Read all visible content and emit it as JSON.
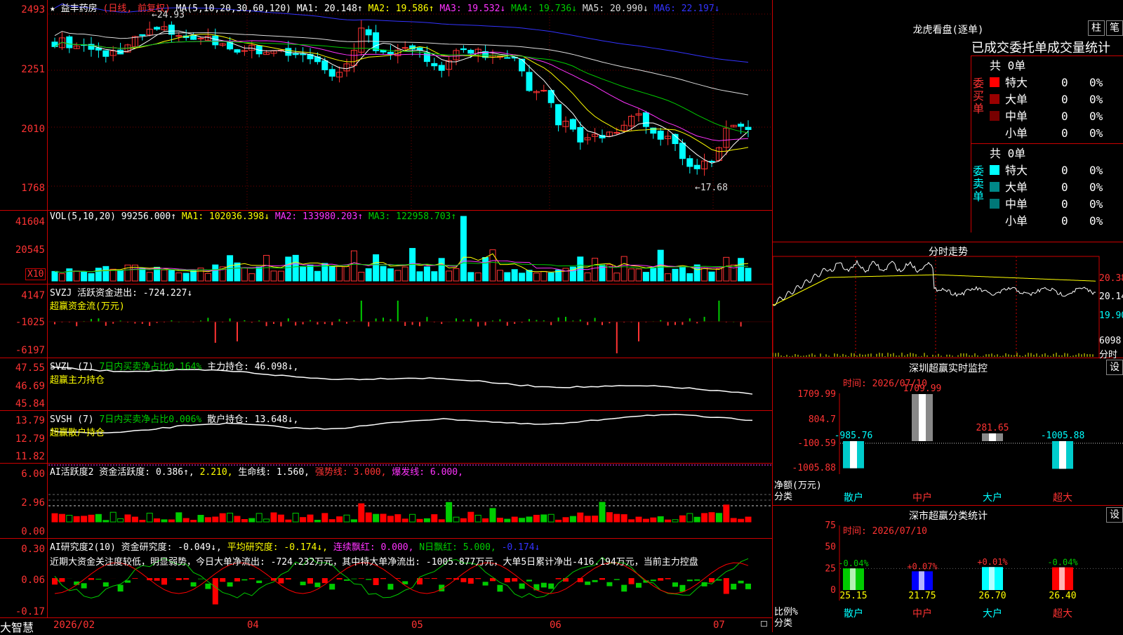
{
  "stock": {
    "star": "★",
    "name": "益丰药房",
    "period": "(日线, 前复权)"
  },
  "ma": {
    "label": "MA(5,10,20,30,60,120)",
    "ma1": "MA1: 20.148↑",
    "ma2": "MA2: 19.586↑",
    "ma3": "MA3: 19.532↓",
    "ma4": "MA4: 19.736↓",
    "ma5": "MA5: 20.990↓",
    "ma6": "MA6: 22.197↓"
  },
  "kline": {
    "y_labels": [
      "2493",
      "2251",
      "2010",
      "1768"
    ],
    "high_label": "←24.93",
    "low_label": "←17.68"
  },
  "vol": {
    "label": "VOL(5,10,20)",
    "v": "99256.000↑",
    "ma1": "MA1: 102036.398↓",
    "ma2": "MA2: 133980.203↑",
    "ma3": "MA3: 122958.703↑",
    "y_labels": [
      "41604",
      "20545"
    ],
    "unit": "X10"
  },
  "svzj": {
    "label": "SVZJ  活跃资金进出: -724.227↓",
    "sub": "超赢资金流(万元)",
    "y_labels": [
      "4147",
      "-1025",
      "-6197"
    ]
  },
  "svzl": {
    "label": "SVZL (7)",
    "pct": "7日内买卖净占比0.164%",
    "hold": "主力持仓: 46.098↓,",
    "sub": "超赢主力持仓",
    "y_labels": [
      "47.55",
      "46.69",
      "45.84"
    ]
  },
  "svsh": {
    "label": "SVSH (7)",
    "pct": "7日内买卖净占比0.006%",
    "hold": "散户持仓: 13.648↓,",
    "sub": "超赢散户持仓",
    "y_labels": [
      "13.79",
      "12.79",
      "11.82"
    ]
  },
  "ai1": {
    "label": "AI活跃度2 资金活跃度: 0.386↑,",
    "v2": "2.210,",
    "life": "生命线: 1.560,",
    "strong": "强势线: 3.000,",
    "burst": "爆发线: 6.000,",
    "y_labels": [
      "6.00",
      "2.96",
      "0.00"
    ]
  },
  "ai2": {
    "label": "AI研究度2(10) 资金研究度: -0.049↓,",
    "avg": "平均研究度: -0.174↓,",
    "lianxu": "连续飘红: 0.000,",
    "nday": "N日飘红: 5.000,",
    "last": "-0.174↓",
    "comment": "近期大资金关注度较低，明显弱势，今日大单净流出: -724.232万元，其中特大单净流出: -1005.877万元，大单5日累计净出-416.194万元，当前主力控盘",
    "y_labels": [
      "0.30",
      "0.06",
      "-0.17"
    ]
  },
  "xaxis": {
    "brand": "大智慧",
    "labels": [
      "2026/02",
      "04",
      "05",
      "06",
      "07"
    ]
  },
  "dragon": {
    "title": "龙虎看盘(逐单)",
    "btn1": "柱",
    "btn2": "笔",
    "subtitle": "已成交委托单成交量统计",
    "buy_label": [
      "委",
      "买",
      "单"
    ],
    "sell_label": [
      "委",
      "卖",
      "单"
    ],
    "buy_total": "共 0单",
    "sell_total": "共 0单",
    "buy_rows": [
      {
        "label": "特大",
        "color": "#f00",
        "count": "0",
        "pct": "0%"
      },
      {
        "label": "大单",
        "color": "#900",
        "count": "0",
        "pct": "0%"
      },
      {
        "label": "中单",
        "color": "#700",
        "count": "0",
        "pct": "0%"
      },
      {
        "label": "小单",
        "color": "",
        "count": "0",
        "pct": "0%"
      }
    ],
    "sell_rows": [
      {
        "label": "特大",
        "color": "#0ff",
        "count": "0",
        "pct": "0%"
      },
      {
        "label": "大单",
        "color": "#088",
        "count": "0",
        "pct": "0%"
      },
      {
        "label": "中单",
        "color": "#077",
        "count": "0",
        "pct": "0%"
      },
      {
        "label": "小单",
        "color": "",
        "count": "0",
        "pct": "0%"
      }
    ]
  },
  "intraday": {
    "title": "分时走势",
    "y_labels": [
      "20.38",
      "20.14",
      "19.90"
    ],
    "vol_label": "6098",
    "vol_sub": "分时"
  },
  "sz_monitor": {
    "title": "深圳超赢实时监控",
    "btn": "设",
    "time": "时间: 2026/07/10",
    "y_labels": [
      "1709.99",
      "804.7",
      "-100.59",
      "-1005.88"
    ],
    "ylab1": "净额(万元)",
    "ylab2": "分类",
    "cats": [
      "散户",
      "中户",
      "大户",
      "超大"
    ],
    "values": [
      -985.76,
      1709.99,
      281.65,
      -1005.88
    ],
    "value_labels": [
      "-985.76",
      "1709.99",
      "281.65",
      "-1005.88"
    ]
  },
  "sz_stats": {
    "title": "深市超赢分类统计",
    "btn": "设",
    "time": "时间: 2026/07/10",
    "y_labels": [
      "75",
      "50",
      "25",
      "0"
    ],
    "ylab1": "比例%",
    "ylab2": "分类",
    "cats": [
      "散户",
      "中户",
      "大户",
      "超大"
    ],
    "values": [
      25.15,
      21.75,
      26.7,
      26.4
    ],
    "value_labels": [
      "25.15",
      "21.75",
      "26.70",
      "26.40"
    ],
    "changes": [
      "-0.04%",
      "+0.07%",
      "+0.01%",
      "-0.04%"
    ],
    "colors": [
      "#0c0",
      "#00f",
      "#0ff",
      "#f00"
    ]
  }
}
